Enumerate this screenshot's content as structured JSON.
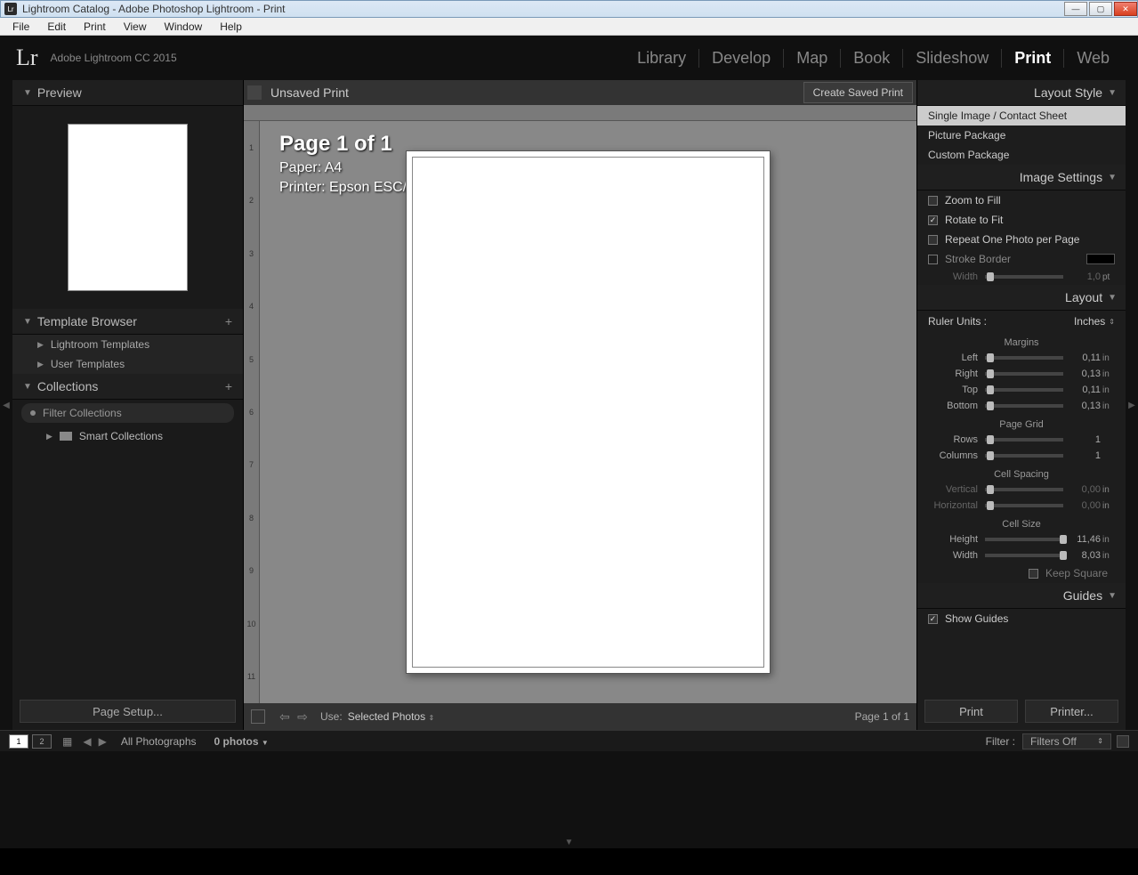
{
  "titlebar": {
    "app_icon": "Lr",
    "title": "Lightroom Catalog - Adobe Photoshop Lightroom - Print"
  },
  "menubar": [
    "File",
    "Edit",
    "Print",
    "View",
    "Window",
    "Help"
  ],
  "header": {
    "logo": "Lr",
    "subtitle": "Adobe Lightroom CC 2015"
  },
  "modules": [
    "Library",
    "Develop",
    "Map",
    "Book",
    "Slideshow",
    "Print",
    "Web"
  ],
  "active_module": "Print",
  "left": {
    "preview_title": "Preview",
    "template_browser_title": "Template Browser",
    "templates": [
      "Lightroom Templates",
      "User Templates"
    ],
    "collections_title": "Collections",
    "filter_placeholder": "Filter Collections",
    "smart_collections": "Smart Collections",
    "page_setup": "Page Setup..."
  },
  "center": {
    "doc_title": "Unsaved Print",
    "create_saved": "Create Saved Print",
    "page_line": "Page 1 of 1",
    "paper_line": "Paper:  A4",
    "printer_line": "Printer:  Epson ESC/P-R",
    "use_label": "Use:",
    "use_value": "Selected Photos",
    "page_status": "Page 1 of 1",
    "ruler_v": [
      "1",
      "2",
      "3",
      "4",
      "5",
      "6",
      "7",
      "8",
      "9",
      "10",
      "11"
    ]
  },
  "right": {
    "layout_style_title": "Layout Style",
    "styles": [
      "Single Image / Contact Sheet",
      "Picture Package",
      "Custom Package"
    ],
    "image_settings_title": "Image Settings",
    "zoom_to_fill": "Zoom to Fill",
    "rotate_to_fit": "Rotate to Fit",
    "repeat_one": "Repeat One Photo per Page",
    "stroke_border": "Stroke Border",
    "width_label": "Width",
    "width_val": "1,0",
    "width_unit": "pt",
    "layout_title": "Layout",
    "ruler_units_label": "Ruler Units :",
    "ruler_units_value": "Inches",
    "margins_title": "Margins",
    "margins": {
      "Left": "0,11",
      "Right": "0,13",
      "Top": "0,11",
      "Bottom": "0,13"
    },
    "unit_in": "in",
    "page_grid_title": "Page Grid",
    "rows_label": "Rows",
    "rows_val": "1",
    "cols_label": "Columns",
    "cols_val": "1",
    "cell_spacing_title": "Cell Spacing",
    "vertical_label": "Vertical",
    "vertical_val": "0,00",
    "horizontal_label": "Horizontal",
    "horizontal_val": "0,00",
    "cell_size_title": "Cell Size",
    "height_label": "Height",
    "height_val": "11,46",
    "width2_label": "Width",
    "width2_val": "8,03",
    "keep_square": "Keep Square",
    "guides_title": "Guides",
    "show_guides": "Show Guides",
    "print_btn": "Print",
    "printer_btn": "Printer..."
  },
  "filmstrip": {
    "source": "All Photographs",
    "count": "0 photos",
    "filter_label": "Filter :",
    "filter_value": "Filters Off",
    "thumb1": "1",
    "thumb2": "2"
  }
}
